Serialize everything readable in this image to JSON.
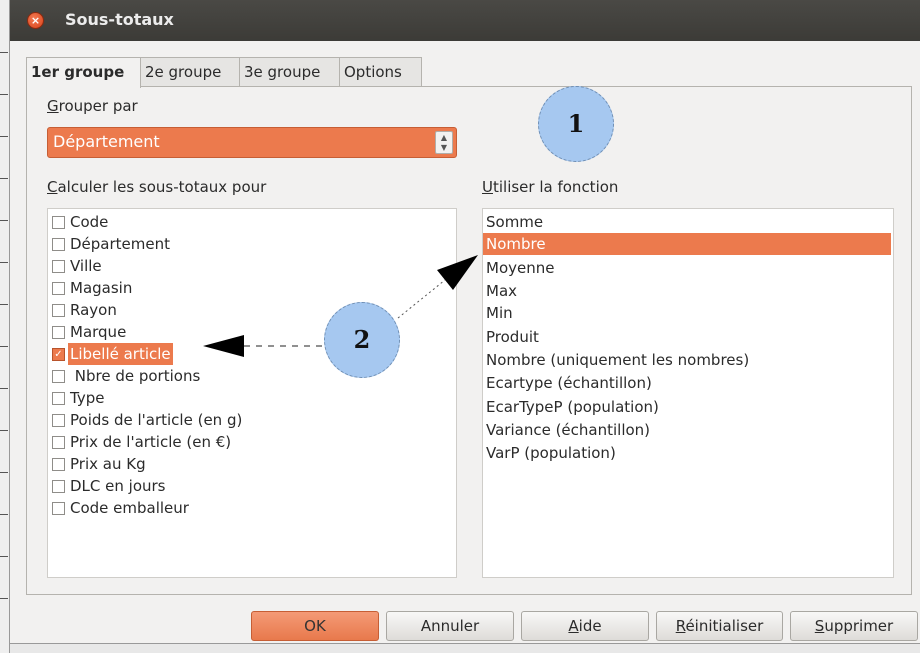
{
  "window": {
    "title": "Sous-totaux",
    "close_glyph": "×"
  },
  "tabs": [
    {
      "label": "1er groupe",
      "active": true
    },
    {
      "label": "2e groupe",
      "active": false
    },
    {
      "label": "3e groupe",
      "active": false
    },
    {
      "label": "Options",
      "active": false
    }
  ],
  "group_by": {
    "label_first": "G",
    "label_rest": "rouper par",
    "value": "Département",
    "spin_icon": "spinner-icon"
  },
  "columns": {
    "label_first": "C",
    "label_rest": "alculer les sous-totaux pour",
    "items": [
      {
        "label": "Code",
        "checked": false
      },
      {
        "label": "Département",
        "checked": false
      },
      {
        "label": "Ville",
        "checked": false
      },
      {
        "label": "Magasin",
        "checked": false
      },
      {
        "label": "Rayon",
        "checked": false
      },
      {
        "label": "Marque",
        "checked": false
      },
      {
        "label": "Libellé article",
        "checked": true,
        "selected": true
      },
      {
        "label": " Nbre de portions",
        "checked": false
      },
      {
        "label": "Type",
        "checked": false
      },
      {
        "label": "Poids de l'article (en g)",
        "checked": false
      },
      {
        "label": "Prix de l'article (en €)",
        "checked": false
      },
      {
        "label": "Prix au Kg",
        "checked": false
      },
      {
        "label": "DLC en jours",
        "checked": false
      },
      {
        "label": "Code emballeur",
        "checked": false
      }
    ]
  },
  "functions": {
    "label_first": "U",
    "label_rest": "tiliser la fonction",
    "items": [
      {
        "label": "Somme"
      },
      {
        "label": "Nombre",
        "selected": true
      },
      {
        "label": "Moyenne"
      },
      {
        "label": "Max"
      },
      {
        "label": "Min"
      },
      {
        "label": "Produit"
      },
      {
        "label": "Nombre (uniquement les nombres)"
      },
      {
        "label": "Ecartype (échantillon)"
      },
      {
        "label": "EcarTypeP (population)"
      },
      {
        "label": "Variance (échantillon)"
      },
      {
        "label": "VarP (population)"
      }
    ]
  },
  "buttons": {
    "ok": "OK",
    "cancel": "Annuler",
    "help_first": "A",
    "help_rest": "ide",
    "reset_first": "R",
    "reset_rest": "éinitialiser",
    "delete_first": "S",
    "delete_rest": "upprimer"
  },
  "callouts": {
    "one": "1",
    "two": "2"
  },
  "colors": {
    "accent": "#ec7a4d",
    "callout": "#a6c8f0",
    "titlebar": "#3c3b37"
  }
}
